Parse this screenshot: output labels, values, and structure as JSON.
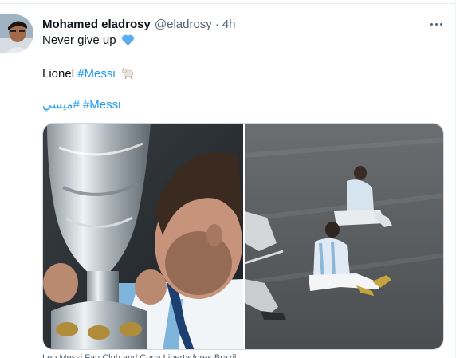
{
  "tweet": {
    "author_name": "Mohamed eladrosy",
    "author_handle": "@eladrosy",
    "separator": "·",
    "time": "4h",
    "line1_text": "Never give up",
    "line1_emoji": "💙",
    "line2_text": "Lionel",
    "line2_hashtag": "#Messi",
    "line2_emoji": "🐐",
    "line3_hashtag_ar": "#ميسي",
    "line3_hashtag": "#Messi",
    "media_caption": "Leo Messi Fan Club and Copa Libertadores Brazil"
  },
  "icons": {
    "more": "more-horizontal-icon",
    "heart": "blue-heart-icon",
    "goat": "goat-icon"
  },
  "colors": {
    "link": "#1d9bf0",
    "text": "#0f1419",
    "secondary": "#536471"
  }
}
